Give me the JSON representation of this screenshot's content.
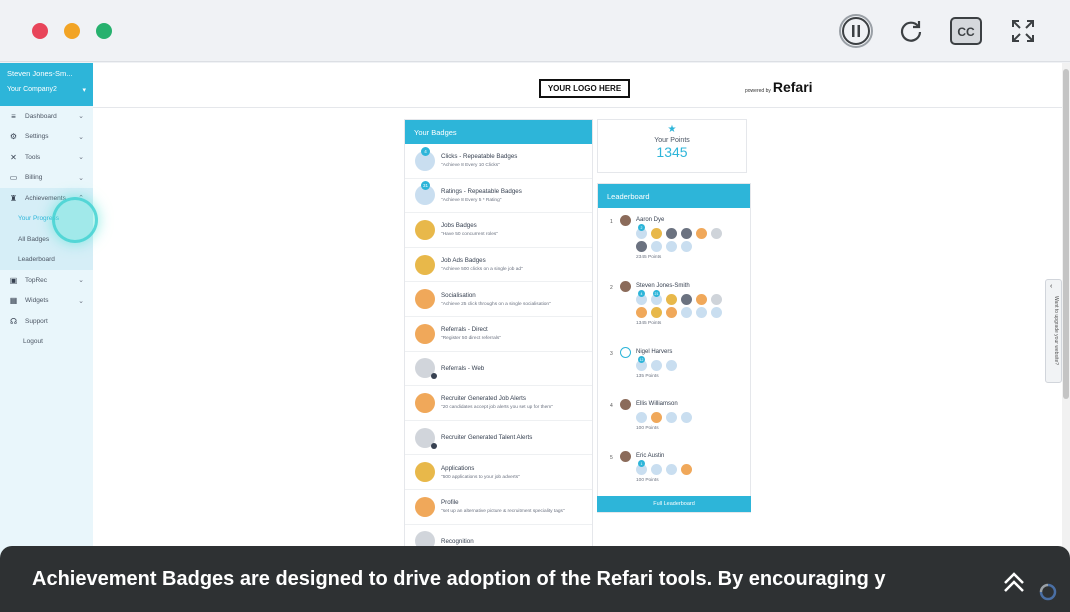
{
  "player": {
    "controls": [
      "pause-button",
      "replay-button",
      "captions-button",
      "fullscreen-button"
    ],
    "cc_label": "CC"
  },
  "sidebar": {
    "user": "Steven Jones-Sm...",
    "company": "Your Company2",
    "items": [
      {
        "label": "Dashboard",
        "icon": "dashboard-icon"
      },
      {
        "label": "Settings",
        "icon": "gear-icon"
      },
      {
        "label": "Tools",
        "icon": "tools-icon"
      },
      {
        "label": "Billing",
        "icon": "billing-icon"
      },
      {
        "label": "Achievements",
        "icon": "trophy-icon"
      },
      {
        "label": "TopRec",
        "icon": "toprec-icon"
      },
      {
        "label": "Widgets",
        "icon": "widgets-icon"
      },
      {
        "label": "Support",
        "icon": "headset-icon"
      },
      {
        "label": "Logout",
        "icon": ""
      }
    ],
    "achievements_sub": [
      "Your Progress",
      "All Badges",
      "Leaderboard"
    ]
  },
  "header": {
    "logo_text": "YOUR LOGO HERE",
    "powered_by": "powered by",
    "brand": "Refari"
  },
  "badges": {
    "title": "Your Badges",
    "items": [
      {
        "title": "Clicks - Repeatable Badges",
        "desc": "\"Achieve 8 Every 10 Clicks\"",
        "count": "4",
        "color": "#c9def0"
      },
      {
        "title": "Ratings - Repeatable Badges",
        "desc": "\"Achieve 8 Every 5 * Rating\"",
        "count": "31",
        "color": "#c9def0"
      },
      {
        "title": "Jobs Badges",
        "desc": "\"Have 50 concurrent roles\"",
        "count": "",
        "color": "#e8b84a"
      },
      {
        "title": "Job Ads Badges",
        "desc": "\"Achieve 500 clicks on a single job ad\"",
        "count": "",
        "color": "#e8b84a"
      },
      {
        "title": "Socialisation",
        "desc": "\"Achieve 25 click throughs on a single socialisation\"",
        "count": "",
        "color": "#f0a85a"
      },
      {
        "title": "Referrals - Direct",
        "desc": "\"Register 50 direct referrals\"",
        "count": "",
        "color": "#f0a85a"
      },
      {
        "title": "Referrals - Web",
        "desc": "",
        "count": "",
        "color": "#d1d5db"
      },
      {
        "title": "Recruiter Generated Job Alerts",
        "desc": "\"20 candidates accept job alerts you set up for them\"",
        "count": "",
        "color": "#f0a85a"
      },
      {
        "title": "Recruiter Generated Talent Alerts",
        "desc": "",
        "count": "",
        "color": "#d1d5db"
      },
      {
        "title": "Applications",
        "desc": "\"500 applications to your job adverts\"",
        "count": "",
        "color": "#e8b84a"
      },
      {
        "title": "Profile",
        "desc": "\"set up an alternative picture & recruitment speciality tags\"",
        "count": "",
        "color": "#f0a85a"
      },
      {
        "title": "Recognition",
        "desc": "",
        "count": "",
        "color": "#d1d5db"
      }
    ]
  },
  "points": {
    "label": "Your Points",
    "value": "1345"
  },
  "leaderboard": {
    "title": "Leaderboard",
    "entries": [
      {
        "rank": "1",
        "name": "Aaron Dye",
        "points": "2345 Points"
      },
      {
        "rank": "2",
        "name": "Steven Jones-Smith",
        "points": "1345 Points"
      },
      {
        "rank": "3",
        "name": "Nigel Harvers",
        "points": "135 Points"
      },
      {
        "rank": "4",
        "name": "Ellis Williamson",
        "points": "100 Points"
      },
      {
        "rank": "5",
        "name": "Eric Austin",
        "points": "100 Points"
      }
    ],
    "button": "Full Leaderboard"
  },
  "side_tab": {
    "text": "Want to upgrade your website?"
  },
  "caption": {
    "text": "Achievement Badges are designed to drive adoption of the Refari tools. By encouraging y"
  },
  "colors": {
    "accent": "#2db5d9",
    "caption_bg": "#2e3133"
  }
}
